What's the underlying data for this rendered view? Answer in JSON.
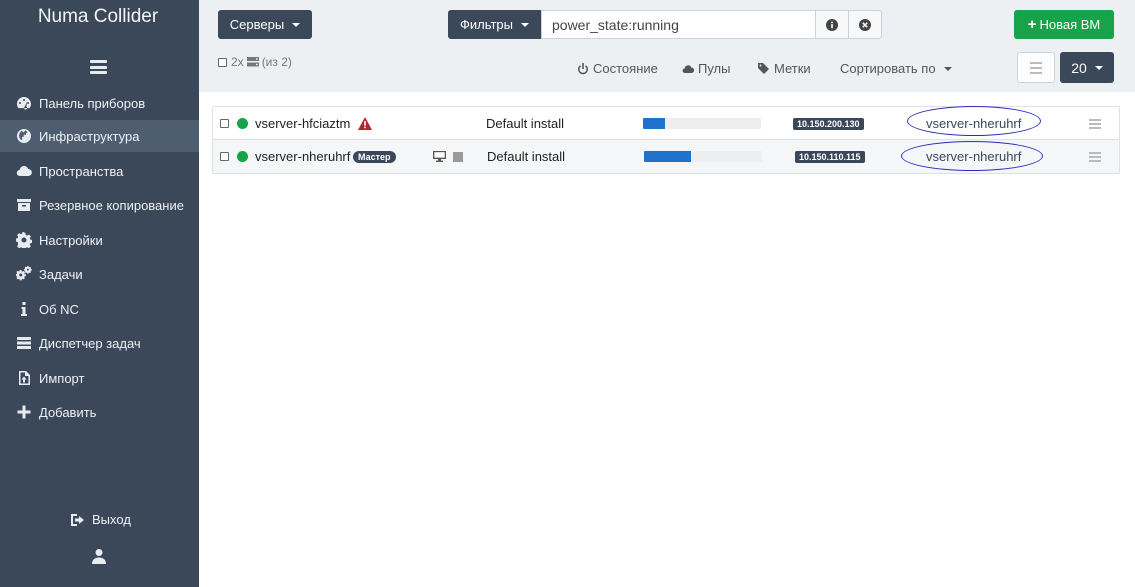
{
  "app": {
    "title": "Numa Collider"
  },
  "sidebar": {
    "items": [
      {
        "label": "Панель приборов",
        "icon": "dashboard-icon"
      },
      {
        "label": "Инфраструктура",
        "icon": "globe-icon",
        "active": true
      },
      {
        "label": "Пространства",
        "icon": "cloud-icon"
      },
      {
        "label": "Резервное копирование",
        "icon": "archive-icon"
      },
      {
        "label": "Настройки",
        "icon": "gear-icon"
      },
      {
        "label": "Задачи",
        "icon": "gears-icon"
      },
      {
        "label": "Об NC",
        "icon": "info-icon"
      },
      {
        "label": "Диспетчер задач",
        "icon": "tasks-icon"
      },
      {
        "label": "Импорт",
        "icon": "file-import-icon"
      },
      {
        "label": "Добавить",
        "icon": "plus-icon"
      }
    ],
    "logout_label": "Выход"
  },
  "toolbar": {
    "type_dropdown": "Серверы",
    "filters_button": "Фильтры",
    "search_value": "power_state:running",
    "new_vm_label": "Новая ВМ",
    "selection_prefix": "2x",
    "selection_suffix": "(из 2)",
    "state_label": "Состояние",
    "pools_label": "Пулы",
    "tags_label": "Метки",
    "sort_label": "Сортировать по",
    "page_size": "20"
  },
  "vms": [
    {
      "name": "vserver-hfciaztm",
      "status": "running",
      "warning": true,
      "master": false,
      "description": "Default install",
      "usage": 0.19,
      "ip": "10.150.200.130",
      "host": "vserver-nheruhrf"
    },
    {
      "name": "vserver-nheruhrf",
      "status": "running",
      "warning": false,
      "master": true,
      "master_label": "Мастер",
      "description": "Default install",
      "usage": 0.4,
      "ip": "10.150.110.115",
      "host": "vserver-nheruhrf"
    }
  ],
  "colors": {
    "sidebar_bg": "#3b4859",
    "accent_green": "#16a34a",
    "progress_blue": "#1f73cc",
    "warning_red": "#b3262d",
    "annotation_oval": "#2d2dbd"
  }
}
